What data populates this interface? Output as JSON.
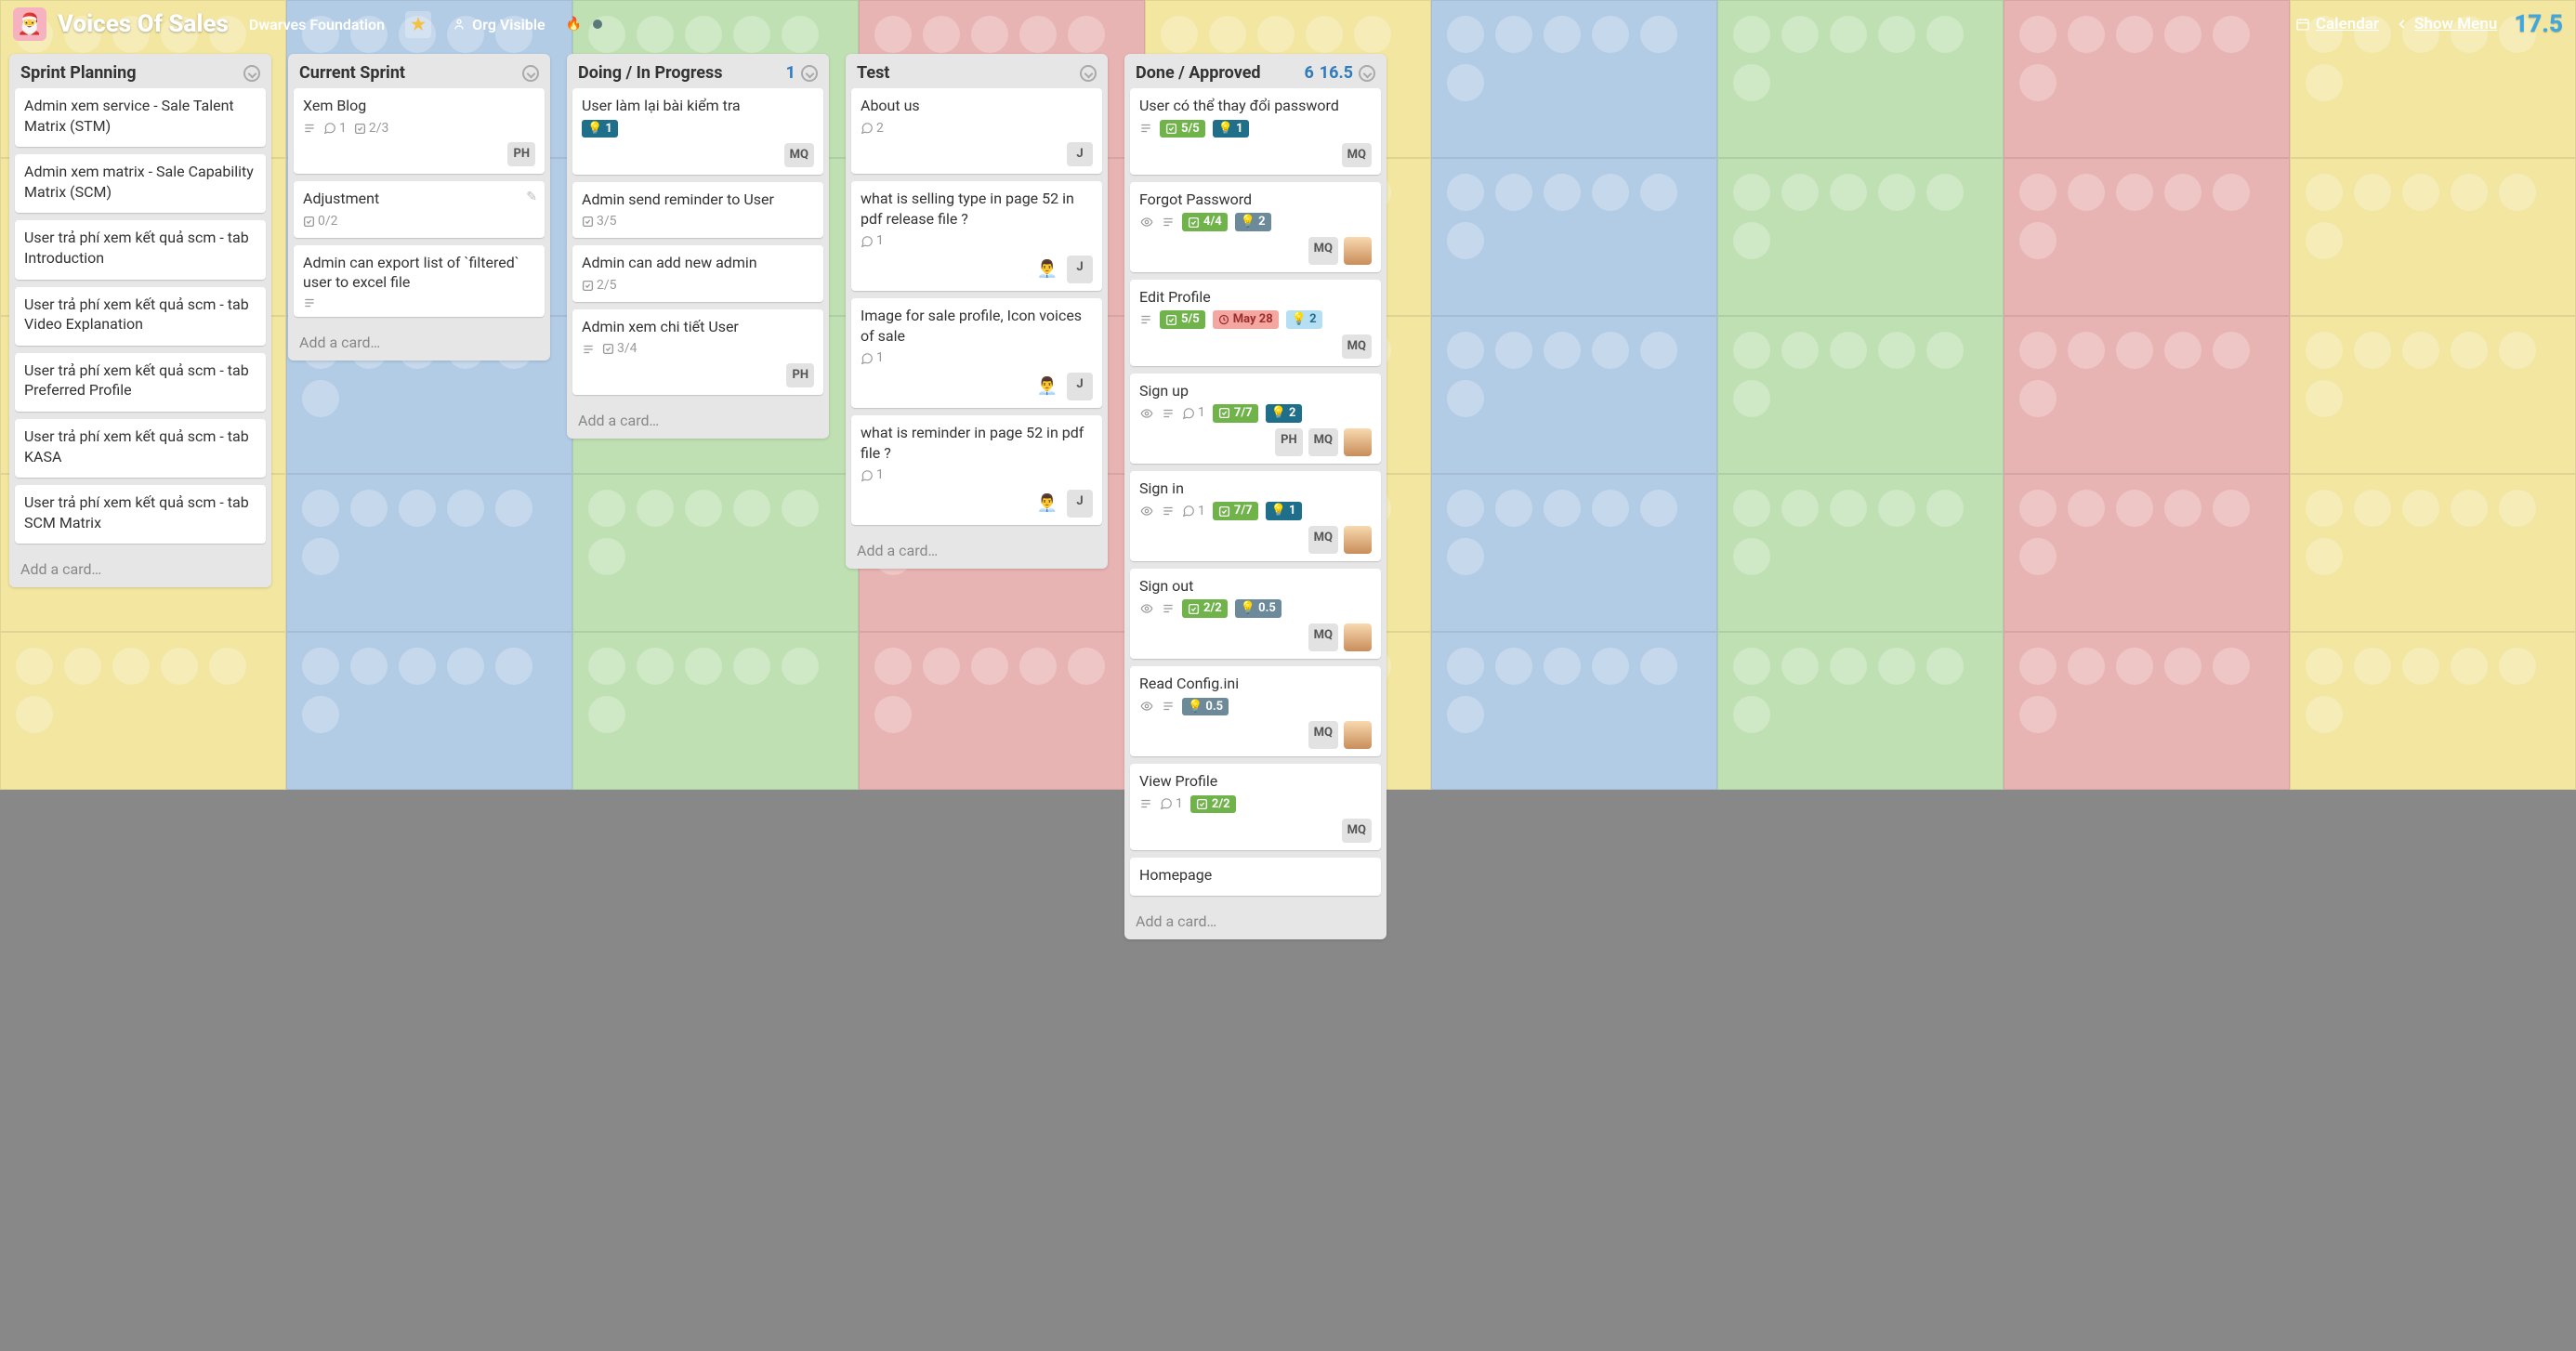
{
  "header": {
    "board_title": "Voices Of Sales",
    "org": "Dwarves Foundation",
    "visibility": "Org Visible",
    "calendar": "Calendar",
    "show_menu": "Show Menu",
    "big_number": "17.5"
  },
  "add_card_label": "Add a card…",
  "lists": [
    {
      "title": "Sprint Planning",
      "cards": [
        {
          "title": "Admin xem service - Sale Talent Matrix (STM)"
        },
        {
          "title": "Admin xem matrix - Sale Capability Matrix (SCM)"
        },
        {
          "title": "User trả phí xem kết quả scm - tab Introduction"
        },
        {
          "title": "User trả phí xem kết quả scm - tab Video Explanation"
        },
        {
          "title": "User trả phí xem kết quả scm - tab Preferred Profile"
        },
        {
          "title": "User trả phí xem kết quả scm - tab KASA"
        },
        {
          "title": "User trả phí xem kết quả scm - tab SCM Matrix"
        }
      ]
    },
    {
      "title": "Current Sprint",
      "cards": [
        {
          "title": "Xem Blog",
          "desc": true,
          "comments": "1",
          "check": "2/3",
          "members": [
            "PH"
          ]
        },
        {
          "title": "Adjustment",
          "check": "0/2",
          "pencil": true
        },
        {
          "title": "Admin can export list of `filtered` user to excel file",
          "desc": true
        }
      ]
    },
    {
      "title": "Doing / In Progress",
      "count1": "1",
      "cards": [
        {
          "title": "User làm lại bài kiểm tra",
          "point_teal": "1",
          "members": [
            "MQ"
          ]
        },
        {
          "title": "Admin send reminder to User",
          "check": "3/5"
        },
        {
          "title": "Admin can add new admin",
          "check": "2/5"
        },
        {
          "title": "Admin xem chi tiết User",
          "desc": true,
          "check": "3/4",
          "members": [
            "PH"
          ]
        }
      ]
    },
    {
      "title": "Test",
      "cards": [
        {
          "title": "About us",
          "comments": "2",
          "members": [
            "J"
          ]
        },
        {
          "title": "what is selling type in page 52 in pdf release file ?",
          "comments": "1",
          "avatar": true,
          "members": [
            "J"
          ]
        },
        {
          "title": "Image for sale profile, Icon voices of sale",
          "comments": "1",
          "avatar": true,
          "members": [
            "J"
          ]
        },
        {
          "title": "what is reminder in page 52 in pdf file ?",
          "comments": "1",
          "avatar": true,
          "members": [
            "J"
          ]
        }
      ]
    },
    {
      "title": "Done / Approved",
      "count1": "6",
      "count2": "16.5",
      "cards": [
        {
          "title": "User có thể thay đổi password",
          "desc": true,
          "check_done": "5/5",
          "point_teal": "1",
          "members": [
            "MQ"
          ]
        },
        {
          "title": "Forgot Password",
          "eye": true,
          "desc": true,
          "check_done": "4/4",
          "point_steel": "2",
          "members": [
            "MQ"
          ],
          "avatar_person": true
        },
        {
          "title": "Edit Profile",
          "desc": true,
          "check_done": "5/5",
          "date": "May 28",
          "point_lt": "2",
          "members": [
            "MQ"
          ]
        },
        {
          "title": "Sign up",
          "eye": true,
          "desc": true,
          "comments": "1",
          "check_done": "7/7",
          "point_teal": "2",
          "members": [
            "PH",
            "MQ"
          ],
          "avatar_person": true
        },
        {
          "title": "Sign in",
          "eye": true,
          "desc": true,
          "comments": "1",
          "check_done": "7/7",
          "point_teal": "1",
          "members": [
            "MQ"
          ],
          "avatar_person": true
        },
        {
          "title": "Sign out",
          "eye": true,
          "desc": true,
          "check_done": "2/2",
          "point_steel": "0.5",
          "members": [
            "MQ"
          ],
          "avatar_person": true
        },
        {
          "title": "Read Config.ini",
          "eye": true,
          "desc": true,
          "point_steel": "0.5",
          "members": [
            "MQ"
          ],
          "avatar_person": true
        },
        {
          "title": "View Profile",
          "desc": true,
          "comments": "1",
          "check_done": "2/2",
          "members": [
            "MQ"
          ]
        },
        {
          "title": "Homepage"
        }
      ]
    }
  ]
}
